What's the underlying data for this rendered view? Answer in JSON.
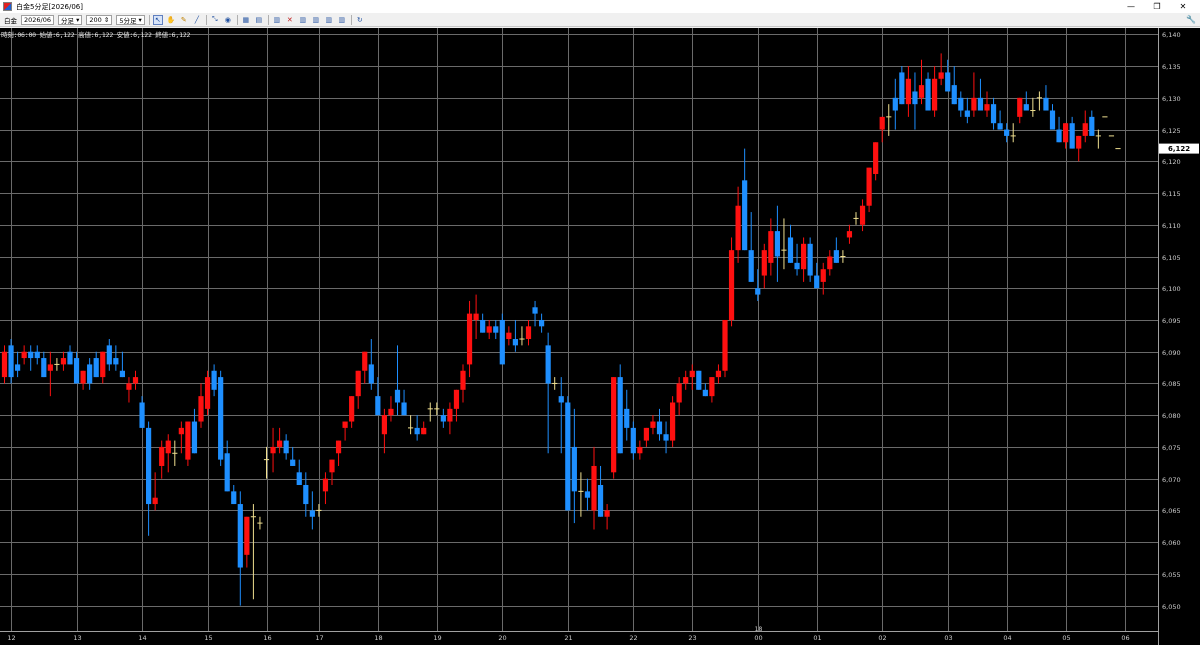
{
  "window": {
    "title": "白金5分足[2026/06]",
    "controls": {
      "minimize": "—",
      "maximize": "❐",
      "close": "✕"
    }
  },
  "toolbar": {
    "symbol": "白金",
    "contract": "2026/06",
    "bar_type": "分足",
    "bar_count": "200",
    "interval": "5分足",
    "icons": [
      "cursor-icon",
      "hand-icon",
      "pencil-icon",
      "line-icon",
      "zoom-icon",
      "globe-icon",
      "grid-icon",
      "table-icon",
      "bar-chart-icon",
      "indicator-icon",
      "volume-icon",
      "compare-icon",
      "sub-chart-icon",
      "settings-chart-icon",
      "refresh-icon"
    ],
    "wrench_icon": "wrench-icon"
  },
  "info": {
    "text": "時刻:06:00 始値:6,122 高値:6,122 安値:6,122 終値:6,122"
  },
  "chart_data": {
    "type": "candlestick",
    "ylim": [
      6046,
      6141
    ],
    "yticks": [
      "6,050",
      "6,055",
      "6,060",
      "6,065",
      "6,070",
      "6,075",
      "6,080",
      "6,085",
      "6,090",
      "6,095",
      "6,100",
      "6,105",
      "6,110",
      "6,115",
      "6,120",
      "6,125",
      "6,130",
      "6,135",
      "6,140"
    ],
    "ytick_values": [
      6050,
      6055,
      6060,
      6065,
      6070,
      6075,
      6080,
      6085,
      6090,
      6095,
      6100,
      6105,
      6110,
      6115,
      6120,
      6125,
      6130,
      6135,
      6140
    ],
    "last_price": "6,122",
    "last_price_value": 6122,
    "xticks": [
      {
        "label": "12",
        "bar": 1
      },
      {
        "label": "13",
        "bar": 11
      },
      {
        "label": "14",
        "bar": 21
      },
      {
        "label": "15",
        "bar": 31
      },
      {
        "label": "16",
        "bar": 40
      },
      {
        "label": "17",
        "bar": 48
      },
      {
        "label": "18",
        "bar": 57
      },
      {
        "label": "19",
        "bar": 66
      },
      {
        "label": "20",
        "bar": 76
      },
      {
        "label": "21",
        "bar": 86
      },
      {
        "label": "22",
        "bar": 96
      },
      {
        "label": "23",
        "bar": 105
      },
      {
        "label": "00",
        "bar": 115
      },
      {
        "label": "01",
        "bar": 124
      },
      {
        "label": "02",
        "bar": 134
      },
      {
        "label": "03",
        "bar": 144
      },
      {
        "label": "04",
        "bar": 153
      },
      {
        "label": "05",
        "bar": 162
      },
      {
        "label": "06",
        "bar": 171
      }
    ],
    "date_marker": {
      "label": "18",
      "bar": 115
    },
    "colors": {
      "up": "#ff1010",
      "down": "#1e8fff",
      "doji": "#f0e090",
      "grid": "#6a6a6a",
      "axis_text": "#cccccc"
    },
    "ohlc": [
      [
        6086,
        6091,
        6085,
        6090
      ],
      [
        6091,
        6092,
        6085,
        6086
      ],
      [
        6088,
        6090,
        6086,
        6087
      ],
      [
        6089,
        6091,
        6088,
        6090
      ],
      [
        6090,
        6091,
        6087,
        6089
      ],
      [
        6090,
        6091,
        6088,
        6089
      ],
      [
        6089,
        6090,
        6086,
        6086
      ],
      [
        6087,
        6090,
        6083,
        6088
      ],
      [
        6088,
        6089,
        6087,
        6088
      ],
      [
        6088,
        6090,
        6087,
        6089
      ],
      [
        6090,
        6091,
        6088,
        6088
      ],
      [
        6089,
        6090,
        6085,
        6085
      ],
      [
        6085,
        6087,
        6084,
        6087
      ],
      [
        6088,
        6089,
        6084,
        6085
      ],
      [
        6089,
        6090,
        6086,
        6086
      ],
      [
        6086,
        6090,
        6085,
        6090
      ],
      [
        6091,
        6092,
        6087,
        6088
      ],
      [
        6089,
        6091,
        6087,
        6088
      ],
      [
        6087,
        6090,
        6086,
        6086
      ],
      [
        6084,
        6086,
        6082,
        6085
      ],
      [
        6085,
        6087,
        6084,
        6086
      ],
      [
        6082,
        6083,
        6078,
        6078
      ],
      [
        6078,
        6079,
        6061,
        6066
      ],
      [
        6066,
        6071,
        6065,
        6067
      ],
      [
        6072,
        6076,
        6070,
        6075
      ],
      [
        6074,
        6077,
        6071,
        6076
      ],
      [
        6074,
        6076,
        6072,
        6074
      ],
      [
        6077,
        6079,
        6074,
        6078
      ],
      [
        6073,
        6079,
        6072,
        6079
      ],
      [
        6079,
        6081,
        6074,
        6074
      ],
      [
        6079,
        6085,
        6078,
        6083
      ],
      [
        6081,
        6087,
        6080,
        6086
      ],
      [
        6087,
        6088,
        6083,
        6084
      ],
      [
        6086,
        6087,
        6072,
        6073
      ],
      [
        6074,
        6076,
        6068,
        6068
      ],
      [
        6068,
        6069,
        6066,
        6066
      ],
      [
        6066,
        6068,
        6050,
        6056
      ],
      [
        6058,
        6064,
        6056,
        6064
      ],
      [
        6064,
        6066,
        6051,
        6064
      ],
      [
        6063,
        6064,
        6062,
        6063
      ],
      [
        6073,
        6075,
        6070,
        6073
      ],
      [
        6074,
        6078,
        6071,
        6075
      ],
      [
        6075,
        6078,
        6074,
        6076
      ],
      [
        6076,
        6077,
        6073,
        6074
      ],
      [
        6073,
        6075,
        6072,
        6072
      ],
      [
        6071,
        6073,
        6069,
        6069
      ],
      [
        6069,
        6071,
        6064,
        6066
      ],
      [
        6065,
        6068,
        6062,
        6064
      ],
      [
        6065,
        6066,
        6064,
        6065
      ],
      [
        6068,
        6071,
        6066,
        6070
      ],
      [
        6071,
        6073,
        6069,
        6073
      ],
      [
        6074,
        6076,
        6072,
        6076
      ],
      [
        6078,
        6079,
        6076,
        6079
      ],
      [
        6079,
        6083,
        6078,
        6083
      ],
      [
        6083,
        6087,
        6081,
        6087
      ],
      [
        6087,
        6090,
        6085,
        6090
      ],
      [
        6088,
        6092,
        6084,
        6085
      ],
      [
        6083,
        6086,
        6080,
        6080
      ],
      [
        6077,
        6081,
        6074,
        6080
      ],
      [
        6080,
        6083,
        6079,
        6081
      ],
      [
        6084,
        6091,
        6080,
        6082
      ],
      [
        6082,
        6084,
        6080,
        6080
      ],
      [
        6078,
        6080,
        6077,
        6078
      ],
      [
        6078,
        6080,
        6076,
        6077
      ],
      [
        6077,
        6079,
        6077,
        6078
      ],
      [
        6081,
        6082,
        6079,
        6081
      ],
      [
        6081,
        6082,
        6080,
        6081
      ],
      [
        6080,
        6081,
        6078,
        6079
      ],
      [
        6079,
        6082,
        6077,
        6081
      ],
      [
        6081,
        6084,
        6079,
        6084
      ],
      [
        6084,
        6088,
        6082,
        6087
      ],
      [
        6088,
        6098,
        6086,
        6096
      ],
      [
        6095,
        6099,
        6092,
        6096
      ],
      [
        6095,
        6096,
        6093,
        6093
      ],
      [
        6093,
        6095,
        6092,
        6094
      ],
      [
        6094,
        6095,
        6092,
        6093
      ],
      [
        6095,
        6096,
        6088,
        6088
      ],
      [
        6092,
        6094,
        6091,
        6093
      ],
      [
        6092,
        6095,
        6090,
        6091
      ],
      [
        6092,
        6094,
        6091,
        6092
      ],
      [
        6092,
        6095,
        6091,
        6094
      ],
      [
        6097,
        6098,
        6094,
        6096
      ],
      [
        6095,
        6096,
        6093,
        6094
      ],
      [
        6091,
        6093,
        6074,
        6085
      ],
      [
        6085,
        6086,
        6084,
        6085
      ],
      [
        6083,
        6086,
        6074,
        6082
      ],
      [
        6082,
        6083,
        6065,
        6065
      ],
      [
        6075,
        6081,
        6063,
        6068
      ],
      [
        6068,
        6071,
        6064,
        6068
      ],
      [
        6068,
        6070,
        6065,
        6067
      ],
      [
        6065,
        6075,
        6062,
        6072
      ],
      [
        6069,
        6072,
        6064,
        6064
      ],
      [
        6064,
        6066,
        6062,
        6065
      ],
      [
        6071,
        6086,
        6070,
        6086
      ],
      [
        6086,
        6088,
        6074,
        6074
      ],
      [
        6081,
        6084,
        6076,
        6078
      ],
      [
        6078,
        6079,
        6073,
        6074
      ],
      [
        6074,
        6076,
        6073,
        6075
      ],
      [
        6076,
        6078,
        6075,
        6078
      ],
      [
        6078,
        6080,
        6077,
        6079
      ],
      [
        6079,
        6081,
        6076,
        6077
      ],
      [
        6077,
        6079,
        6074,
        6076
      ],
      [
        6076,
        6083,
        6075,
        6082
      ],
      [
        6082,
        6086,
        6080,
        6085
      ],
      [
        6085,
        6087,
        6084,
        6086
      ],
      [
        6086,
        6088,
        6084,
        6087
      ],
      [
        6087,
        6087,
        6084,
        6084
      ],
      [
        6084,
        6085,
        6083,
        6083
      ],
      [
        6083,
        6086,
        6082,
        6086
      ],
      [
        6086,
        6088,
        6085,
        6087
      ],
      [
        6087,
        6095,
        6086,
        6095
      ],
      [
        6095,
        6108,
        6094,
        6106
      ],
      [
        6106,
        6116,
        6104,
        6113
      ],
      [
        6117,
        6122,
        6106,
        6106
      ],
      [
        6106,
        6112,
        6101,
        6101
      ],
      [
        6100,
        6103,
        6098,
        6099
      ],
      [
        6102,
        6107,
        6100,
        6106
      ],
      [
        6104,
        6111,
        6102,
        6109
      ],
      [
        6109,
        6113,
        6101,
        6105
      ],
      [
        6106,
        6111,
        6103,
        6106
      ],
      [
        6108,
        6110,
        6104,
        6104
      ],
      [
        6104,
        6107,
        6102,
        6103
      ],
      [
        6103,
        6108,
        6101,
        6107
      ],
      [
        6107,
        6108,
        6101,
        6102
      ],
      [
        6102,
        6104,
        6100,
        6100
      ],
      [
        6101,
        6104,
        6099,
        6103
      ],
      [
        6103,
        6106,
        6102,
        6105
      ],
      [
        6106,
        6108,
        6104,
        6104
      ],
      [
        6105,
        6106,
        6104,
        6105
      ],
      [
        6108,
        6110,
        6107,
        6109
      ],
      [
        6111,
        6112,
        6110,
        6111
      ],
      [
        6110,
        6114,
        6109,
        6113
      ],
      [
        6113,
        6119,
        6112,
        6119
      ],
      [
        6118,
        6123,
        6117,
        6123
      ],
      [
        6125,
        6127,
        6123,
        6127
      ],
      [
        6127,
        6129,
        6124,
        6127
      ],
      [
        6130,
        6133,
        6125,
        6128
      ],
      [
        6134,
        6135,
        6129,
        6129
      ],
      [
        6129,
        6135,
        6127,
        6133
      ],
      [
        6131,
        6134,
        6125,
        6129
      ],
      [
        6130,
        6136,
        6129,
        6132
      ],
      [
        6133,
        6134,
        6128,
        6128
      ],
      [
        6128,
        6135,
        6127,
        6133
      ],
      [
        6133,
        6137,
        6132,
        6134
      ],
      [
        6134,
        6136,
        6131,
        6131
      ],
      [
        6132,
        6135,
        6129,
        6129
      ],
      [
        6130,
        6131,
        6127,
        6128
      ],
      [
        6128,
        6130,
        6126,
        6127
      ],
      [
        6128,
        6134,
        6127,
        6130
      ],
      [
        6130,
        6133,
        6128,
        6128
      ],
      [
        6128,
        6131,
        6127,
        6129
      ],
      [
        6129,
        6130,
        6125,
        6126
      ],
      [
        6126,
        6128,
        6125,
        6125
      ],
      [
        6125,
        6126,
        6123,
        6124
      ],
      [
        6124,
        6126,
        6123,
        6124
      ],
      [
        6127,
        6130,
        6126,
        6130
      ],
      [
        6129,
        6131,
        6128,
        6128
      ],
      [
        6128,
        6130,
        6127,
        6128
      ],
      [
        6130,
        6131,
        6128,
        6130
      ],
      [
        6130,
        6132,
        6128,
        6128
      ],
      [
        6128,
        6129,
        6125,
        6125
      ],
      [
        6125,
        6127,
        6123,
        6123
      ],
      [
        6123,
        6126,
        6122,
        6126
      ],
      [
        6126,
        6127,
        6122,
        6122
      ],
      [
        6122,
        6124,
        6120,
        6124
      ],
      [
        6124,
        6128,
        6123,
        6126
      ],
      [
        6127,
        6128,
        6124,
        6124
      ],
      [
        6124,
        6125,
        6122,
        6124
      ],
      [
        6127,
        6127,
        6127,
        6127
      ],
      [
        6124,
        6124,
        6124,
        6124
      ],
      [
        6122,
        6122,
        6122,
        6122
      ]
    ]
  }
}
